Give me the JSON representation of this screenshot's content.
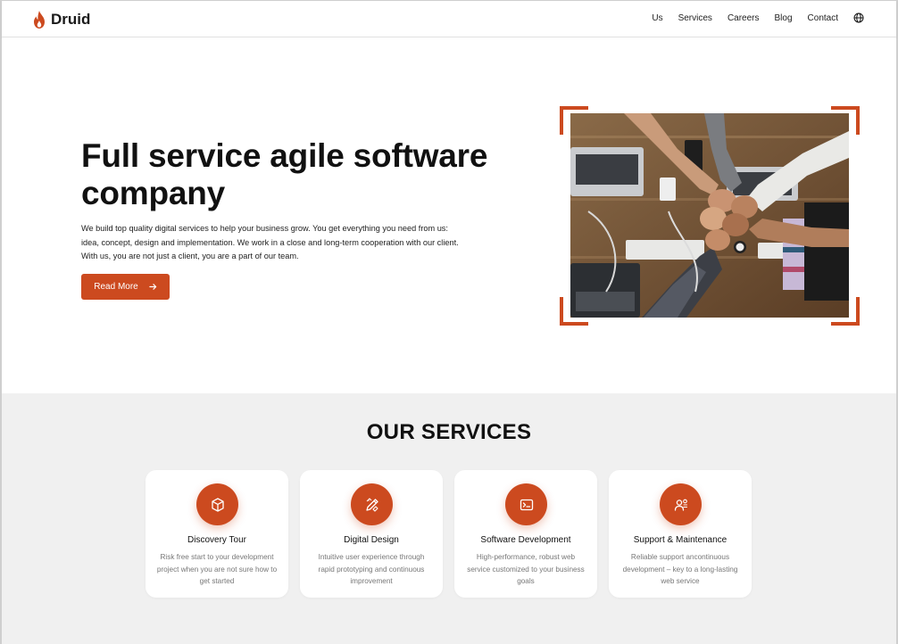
{
  "brand": {
    "name": "Druid",
    "accent": "#cc4a1f"
  },
  "nav": {
    "items": [
      "Us",
      "Services",
      "Careers",
      "Blog",
      "Contact"
    ],
    "language_icon": "globe-icon"
  },
  "hero": {
    "title": "Full service agile software company",
    "description": "We build top quality digital services to help your business grow. You get everything you need from us: idea, concept, design and implementation. We work in a close and long-term cooperation with our client. With us, you are not just a client, you are a part of our team.",
    "button_label": "Read More",
    "button_icon": "arrow-right-icon",
    "image": "team-fist-bump-photo"
  },
  "services": {
    "title": "OUR SERVICES",
    "cards": [
      {
        "icon": "cube-icon",
        "title": "Discovery Tour",
        "description": "Risk free start to your development project when you are not sure how to get started"
      },
      {
        "icon": "pen-ruler-icon",
        "title": "Digital Design",
        "description": "Intuitive user experience through rapid prototyping and continuous improvement"
      },
      {
        "icon": "terminal-icon",
        "title": "Software Development",
        "description": "High-performance, robust web service customized to your business goals"
      },
      {
        "icon": "support-person-icon",
        "title": "Support & Maintenance",
        "description": "Reliable support ancontinuous development – key to a long-lasting web service"
      }
    ]
  }
}
